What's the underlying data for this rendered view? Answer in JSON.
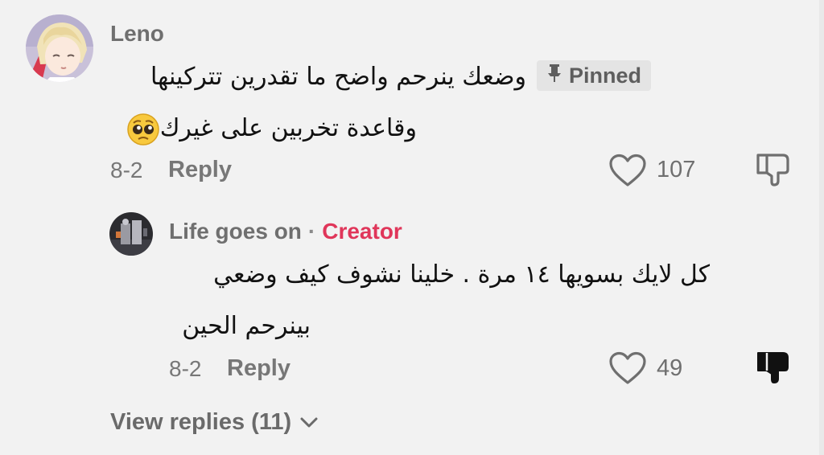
{
  "comments": [
    {
      "username": "Leno",
      "pinned_label": "Pinned",
      "line1": "وضعك ينرحم واضح ما تقدرين تتركينها",
      "line2": "وقاعدة تخربين على غيرك",
      "emoji_icon": "pleading-face-emoji",
      "date": "8-2",
      "reply_label": "Reply",
      "like_count": "107",
      "disliked": false
    }
  ],
  "reply": {
    "username": "Life goes on",
    "separator": "·",
    "creator_label": "Creator",
    "line1": "كل لايك بسويها ١٤ مرة . خلينا نشوف كيف وضعي",
    "line2": "بينرحم الحين",
    "date": "8-2",
    "reply_label": "Reply",
    "like_count": "49",
    "disliked": true
  },
  "view_replies_label": "View replies (11)",
  "colors": {
    "background": "#f2f2f2",
    "creator_accent": "#e0365a",
    "pinned_bg": "#e4e4e4"
  }
}
